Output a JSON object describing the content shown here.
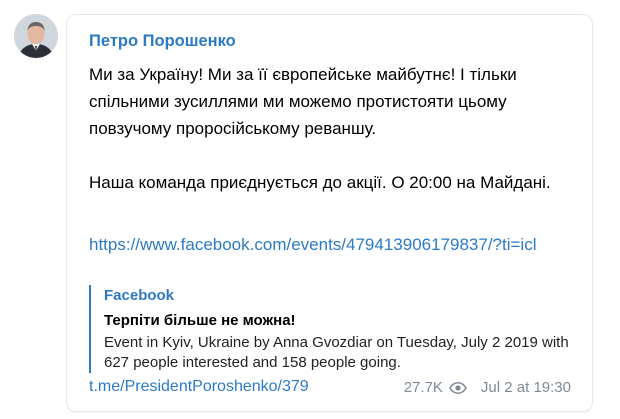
{
  "channel": {
    "author_name": "Петро Порошенко"
  },
  "message": {
    "paragraphs": [
      "Ми за Україну! Ми за її європейське майбутнє! І тільки спільними зусиллями ми можемо протистояти цьому повзучому проросійському реваншу.",
      "Наша команда приєднується до акції. О 20:00 на Майдані."
    ],
    "link_url": "https://www.facebook.com/events/479413906179837/?ti=icl"
  },
  "preview": {
    "site_name": "Facebook",
    "title": "Терпіти більше не можна!",
    "description": "Event in Kyiv, Ukraine by Anna Gvozdiar on Tuesday, July 2 2019 with 627 people interested and 158 people going."
  },
  "footer": {
    "post_link": "t.me/PresidentPoroshenko/379",
    "views": "27.7K",
    "timestamp": "Jul 2 at 19:30"
  },
  "icons": {
    "views": "eye-icon"
  },
  "colors": {
    "link": "#2c7ac4",
    "meta": "#7f8b96",
    "border": "#e4e8ec"
  }
}
